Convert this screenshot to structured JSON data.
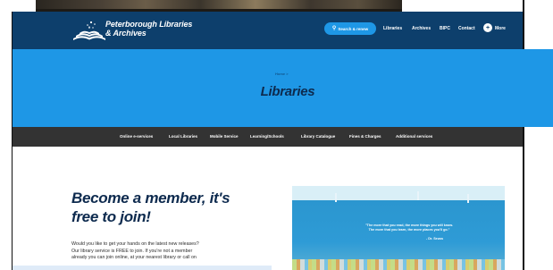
{
  "header": {
    "brand_line1": "Peterborough Libraries",
    "brand_line2": "& Archives",
    "search_button": "Search & renew",
    "nav": [
      "Libraries",
      "Archives",
      "BIPC",
      "Contact"
    ],
    "more_label": "More",
    "colors": {
      "header_bg": "#0d3f6c",
      "accent": "#1e97e6"
    }
  },
  "hero": {
    "breadcrumb": "Home  >",
    "title": "Libraries"
  },
  "subnav": [
    "Online e-services",
    "Local Libraries",
    "Mobile Service",
    "Learning/Schools",
    "Library Catalogue",
    "Fines & Charges",
    "Additional services"
  ],
  "content": {
    "headline_line1": "Become a member, it's",
    "headline_line2": "free to join!",
    "paragraph": [
      "Would you like to get your hands on the latest new releases?",
      "Our library service is FREE to join. If you're not a member",
      "already you can join online, at your nearest library or call on"
    ]
  },
  "image": {
    "quote_line1": "\"The more that you read, the more things you will know.",
    "quote_line2": "The more that you learn, the more places you'll go.\"",
    "quote_author": "- Dr. Seuss"
  }
}
